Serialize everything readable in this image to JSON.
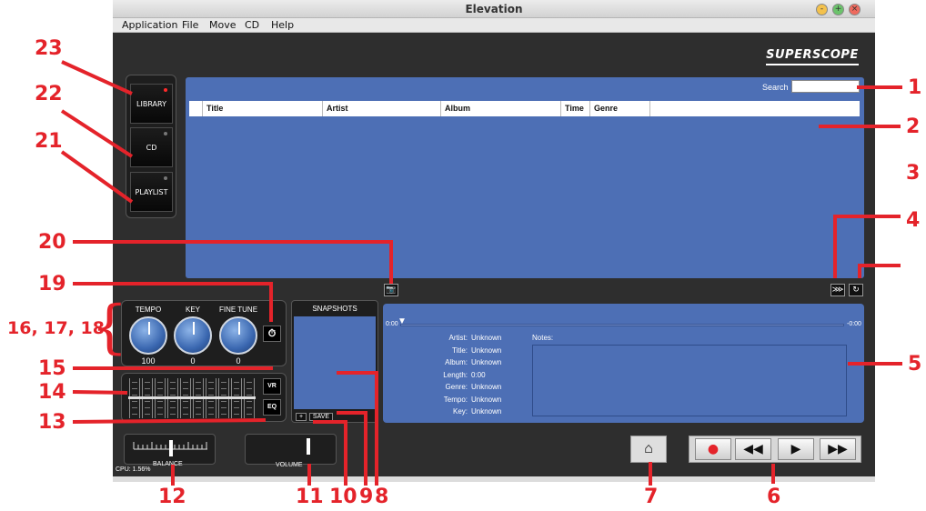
{
  "window": {
    "title": "Elevation",
    "controls": [
      "-",
      "+",
      "×"
    ]
  },
  "menu": [
    "Application",
    "File",
    "Move",
    "CD",
    "Help"
  ],
  "brand": "SUPERSCOPE",
  "modes": [
    {
      "label": "LIBRARY",
      "active": true
    },
    {
      "label": "CD",
      "active": false
    },
    {
      "label": "PLAYLIST",
      "active": false
    }
  ],
  "library": {
    "search_label": "Search",
    "search_value": "",
    "columns": [
      "Title",
      "Artist",
      "Album",
      "Time",
      "Genre"
    ]
  },
  "knobs": [
    {
      "label": "TEMPO",
      "value": "100"
    },
    {
      "label": "KEY",
      "value": "0"
    },
    {
      "label": "FINE TUNE",
      "value": "0"
    }
  ],
  "eq": {
    "vr_label": "VR",
    "eq_label": "EQ",
    "band_levels": [
      0.55,
      0.55,
      0.55,
      0.55,
      0.55,
      0.55,
      0.55,
      0.55,
      0.55,
      0.55
    ]
  },
  "snapshots": {
    "title": "SNAPSHOTS",
    "add_label": "+",
    "save_label": "SAVE"
  },
  "track": {
    "time_start": "0:00",
    "time_end": "-0:00",
    "fields": [
      {
        "label": "Artist:",
        "value": "Unknown"
      },
      {
        "label": "Title:",
        "value": "Unknown"
      },
      {
        "label": "Album:",
        "value": "Unknown"
      },
      {
        "label": "Length:",
        "value": "0:00"
      },
      {
        "label": "Genre:",
        "value": "Unknown"
      },
      {
        "label": "Tempo:",
        "value": "Unknown"
      },
      {
        "label": "Key:",
        "value": "Unknown"
      }
    ],
    "notes_label": "Notes:"
  },
  "balance": {
    "label": "BALANCE",
    "cpu": "CPU: 1.56%",
    "level": 0.5
  },
  "volume": {
    "label": "VOLUME",
    "level": 0.75
  },
  "transport": {
    "record": "●",
    "rewind": "◀◀",
    "play": "▶",
    "fast_forward": "▶▶"
  },
  "metronome": "metronome-icon",
  "icons": {
    "camera": "📷",
    "speed": "⋙",
    "loop": "↻",
    "timer": "⏱"
  },
  "accent_color": "#4d6fb5",
  "callout_color": "#e4232a",
  "callouts": [
    "1",
    "2",
    "3",
    "4",
    "5",
    "6",
    "7",
    "8",
    "9",
    "10",
    "11",
    "12",
    "13",
    "14",
    "15",
    "16, 17, 18",
    "19",
    "20",
    "21",
    "22",
    "23"
  ]
}
